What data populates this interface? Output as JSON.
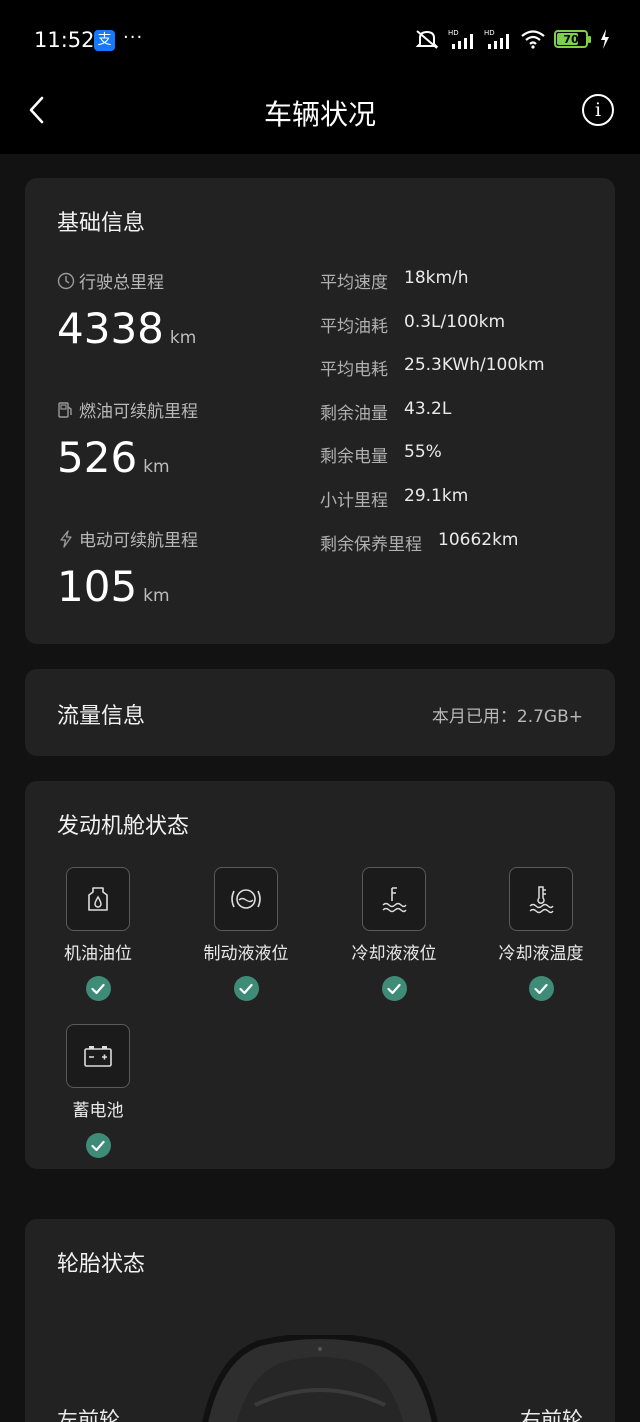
{
  "status_bar": {
    "time": "11:52",
    "alipay_glyph": "支",
    "more_glyph": "···",
    "battery_level": "70",
    "icons": [
      "mute-icon",
      "signal-hd-icon",
      "signal-hd-icon",
      "wifi-icon",
      "battery-icon",
      "charging-icon"
    ]
  },
  "nav": {
    "title": "车辆状况",
    "info_glyph": "i"
  },
  "basic_info": {
    "title": "基础信息",
    "total_mileage_label": "行驶总里程",
    "total_mileage_value": "4338",
    "total_mileage_unit": "km",
    "fuel_range_label": "燃油可续航里程",
    "fuel_range_value": "526",
    "fuel_range_unit": "km",
    "ev_range_label": "电动可续航里程",
    "ev_range_value": "105",
    "ev_range_unit": "km",
    "details": [
      {
        "key": "平均速度",
        "value": "18km/h"
      },
      {
        "key": "平均油耗",
        "value": "0.3L/100km"
      },
      {
        "key": "平均电耗",
        "value": "25.3KWh/100km"
      },
      {
        "key": "剩余油量",
        "value": "43.2L"
      },
      {
        "key": "剩余电量",
        "value": "55%"
      },
      {
        "key": "小计里程",
        "value": "29.1km"
      },
      {
        "key": "剩余保养里程",
        "value": "10662km"
      }
    ]
  },
  "data_usage": {
    "title": "流量信息",
    "summary": "本月已用：2.7GB+"
  },
  "engine": {
    "title": "发动机舱状态",
    "items": [
      {
        "label": "机油油位",
        "icon": "oil-level-icon",
        "status": "ok"
      },
      {
        "label": "制动液液位",
        "icon": "brake-fluid-icon",
        "status": "ok"
      },
      {
        "label": "冷却液液位",
        "icon": "coolant-level-icon",
        "status": "ok"
      },
      {
        "label": "冷却液温度",
        "icon": "coolant-temp-icon",
        "status": "ok"
      },
      {
        "label": "蓄电池",
        "icon": "battery-icon",
        "status": "ok"
      }
    ]
  },
  "tires": {
    "title": "轮胎状态",
    "front_left": "左前轮",
    "front_right": "右前轮"
  },
  "colors": {
    "background": "#121212",
    "card": "#222222",
    "check": "#3e8b78",
    "battery_green": "#7dd04a"
  }
}
